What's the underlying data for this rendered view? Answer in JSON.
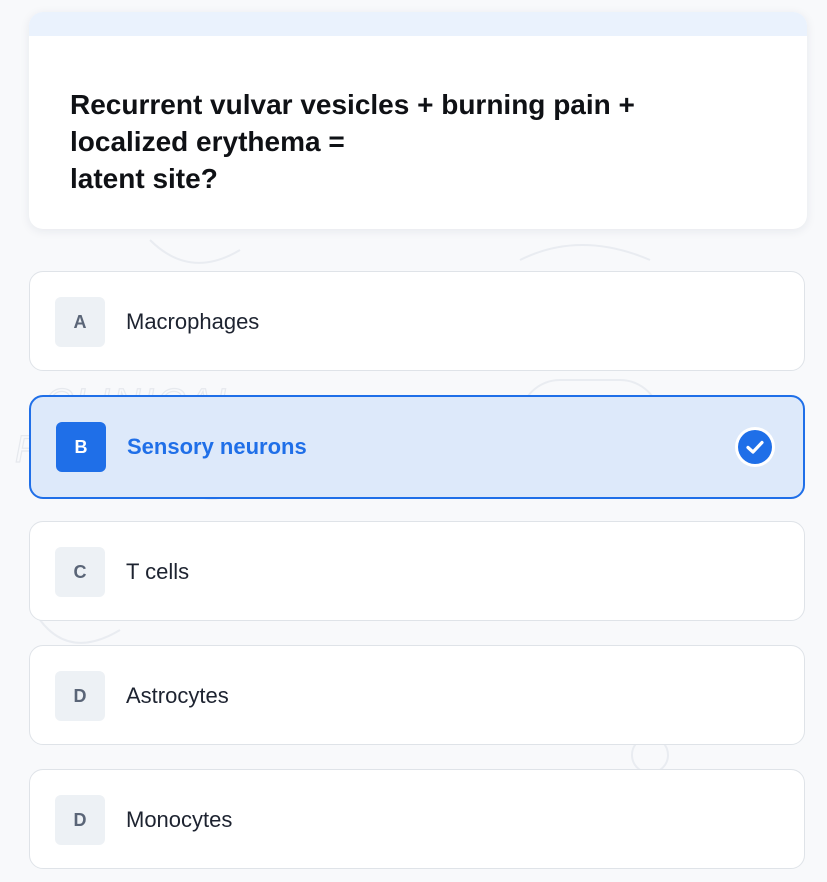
{
  "question": {
    "text": "Recurrent vulvar vesicles + burning pain +\nlocalized erythema =\nlatent site?"
  },
  "options": [
    {
      "letter": "A",
      "label": "Macrophages",
      "selected": false
    },
    {
      "letter": "B",
      "label": "Sensory neurons",
      "selected": true
    },
    {
      "letter": "C",
      "label": "T cells",
      "selected": false
    },
    {
      "letter": "D",
      "label": "Astrocytes",
      "selected": false
    },
    {
      "letter": "D",
      "label": "Monocytes",
      "selected": false
    }
  ],
  "background": {
    "watermark_lines": [
      "CLINICAL",
      "REASONING"
    ],
    "rx_symbol": "Rx"
  },
  "colors": {
    "accent": "#1f6fe8",
    "selected_bg": "#dde9fa",
    "page_bg": "#f8f9fb",
    "text_dark": "#0f1115"
  },
  "icons": {
    "selected_indicator": "checkmark-circle-icon"
  }
}
